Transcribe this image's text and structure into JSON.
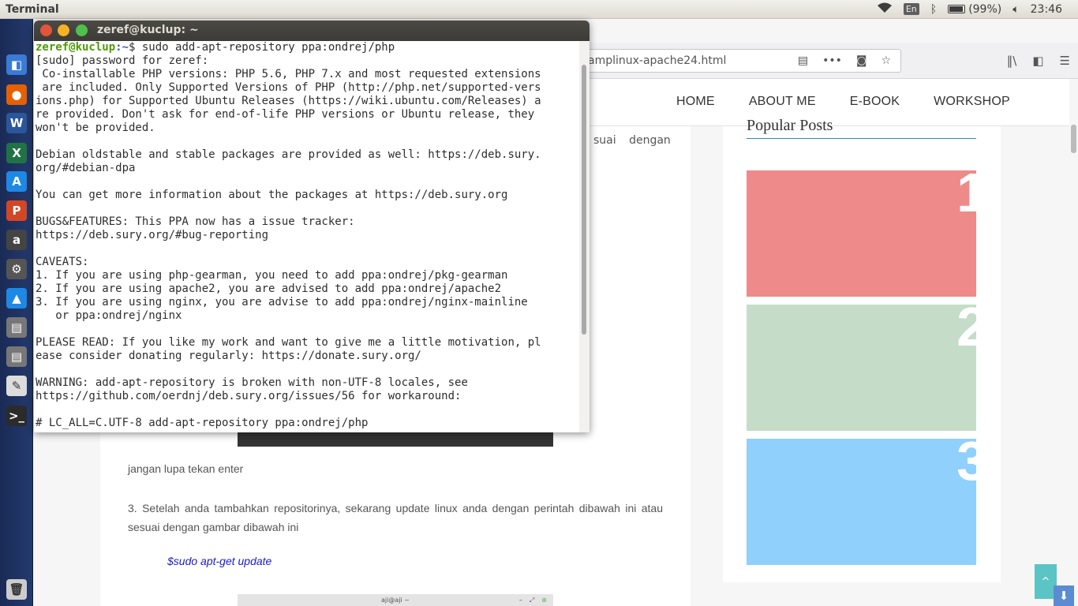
{
  "panel": {
    "app_title": "Terminal",
    "keyboard_layout": "En",
    "battery_percent": "(99%)",
    "battery_level": 0.99,
    "time": "23:46"
  },
  "launcher": {
    "items": [
      {
        "name": "launcher-item-dash",
        "glyph": "",
        "color": "#ffffff"
      },
      {
        "name": "launcher-item-files",
        "glyph": "◧",
        "color": "#3a7bd5"
      },
      {
        "name": "launcher-item-firefox",
        "glyph": "●",
        "color": "#e66000"
      },
      {
        "name": "launcher-item-word",
        "glyph": "W",
        "color": "#2b579a"
      },
      {
        "name": "launcher-item-excel",
        "glyph": "X",
        "color": "#217346"
      },
      {
        "name": "launcher-item-appstore",
        "glyph": "A",
        "color": "#1e88e5"
      },
      {
        "name": "launcher-item-powerpoint",
        "glyph": "P",
        "color": "#d24726"
      },
      {
        "name": "launcher-item-amazon",
        "glyph": "a",
        "color": "#444444"
      },
      {
        "name": "launcher-item-settings",
        "glyph": "⚙",
        "color": "#555555"
      },
      {
        "name": "launcher-item-software",
        "glyph": "▲",
        "color": "#1e88e5"
      },
      {
        "name": "launcher-item-drive-1",
        "glyph": "▤",
        "color": "#777777"
      },
      {
        "name": "launcher-item-drive-2",
        "glyph": "▤",
        "color": "#777777"
      },
      {
        "name": "launcher-item-editor",
        "glyph": "✎",
        "color": "#dddddd"
      },
      {
        "name": "launcher-item-terminal",
        "glyph": ">_",
        "color": "#2b2b2b"
      },
      {
        "name": "launcher-item-trash",
        "glyph": "🗑",
        "color": "#cccccc"
      }
    ]
  },
  "browser": {
    "url_fragment": "amplinux-apache24.html",
    "nav": [
      "HOME",
      "ABOUT ME",
      "E-BOOK",
      "WORKSHOP"
    ],
    "content": {
      "fragment_text": "suai dengan",
      "para1": "jangan lupa tekan enter",
      "para2": "3. Setelah anda tambahkan repositorinya, sekarang update linux anda dengan perintah dibawah ini atau sesuai dengan gambar dibawah ini",
      "command": "$sudo apt-get update",
      "screenshot_title": "aji@aji ~"
    },
    "sidebar": {
      "title": "Popular Posts",
      "cards": [
        {
          "number": "1",
          "color": "#ee8a8a"
        },
        {
          "number": "2",
          "color": "#c5ddc8"
        },
        {
          "number": "3",
          "color": "#90d0fc"
        }
      ]
    }
  },
  "terminal": {
    "title": "zeref@kuclup: ~",
    "prompt_user": "zeref@kuclup",
    "prompt_path": ":~",
    "prompt_cmd": "$ sudo add-apt-repository ppa:ondrej/php",
    "output": "[sudo] password for zeref: \n Co-installable PHP versions: PHP 5.6, PHP 7.x and most requested extensions\n are included. Only Supported Versions of PHP (http://php.net/supported-vers\nions.php) for Supported Ubuntu Releases (https://wiki.ubuntu.com/Releases) a\nre provided. Don't ask for end-of-life PHP versions or Ubuntu release, they \nwon't be provided.\n\nDebian oldstable and stable packages are provided as well: https://deb.sury.\norg/#debian-dpa\n\nYou can get more information about the packages at https://deb.sury.org\n\nBUGS&FEATURES: This PPA now has a issue tracker:\nhttps://deb.sury.org/#bug-reporting\n\nCAVEATS:\n1. If you are using php-gearman, you need to add ppa:ondrej/pkg-gearman\n2. If you are using apache2, you are advised to add ppa:ondrej/apache2\n3. If you are using nginx, you are advise to add ppa:ondrej/nginx-mainline\n   or ppa:ondrej/nginx\n\nPLEASE READ: If you like my work and want to give me a little motivation, pl\nease consider donating regularly: https://donate.sury.org/\n\nWARNING: add-apt-repository is broken with non-UTF-8 locales, see \nhttps://github.com/oerdnj/deb.sury.org/issues/56 for workaround:\n\n# LC_ALL=C.UTF-8 add-apt-repository ppa:ondrej/php"
  }
}
